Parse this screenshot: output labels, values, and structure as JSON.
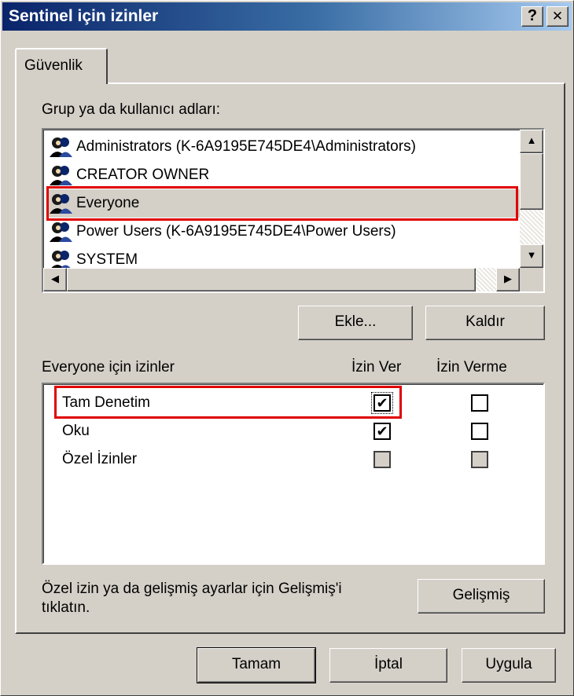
{
  "window": {
    "title": "Sentinel için izinler",
    "help_label": "?",
    "close_label": "✕"
  },
  "tabs": [
    {
      "label": "Güvenlik"
    }
  ],
  "users": {
    "label": "Grup ya da kullanıcı adları:",
    "items": [
      {
        "name": "Administrators (K-6A9195E745DE4\\Administrators)"
      },
      {
        "name": "CREATOR OWNER"
      },
      {
        "name": "Everyone",
        "selected": true
      },
      {
        "name": "Power Users (K-6A9195E745DE4\\Power Users)"
      },
      {
        "name": "SYSTEM"
      }
    ],
    "add_label": "Ekle...",
    "remove_label": "Kaldır"
  },
  "permissions": {
    "label": "Everyone için izinler",
    "allow_header": "İzin Ver",
    "deny_header": "İzin Verme",
    "rows": [
      {
        "name": "Tam Denetim",
        "allow": true,
        "deny": false,
        "disabled": false
      },
      {
        "name": "Oku",
        "allow": true,
        "deny": false,
        "disabled": false
      },
      {
        "name": "Özel İzinler",
        "allow": false,
        "deny": false,
        "disabled": true
      }
    ]
  },
  "advanced": {
    "text_line1": "Özel izin ya da gelişmiş ayarlar için Gelişmiş'i",
    "text_line2": "tıklatın.",
    "button_label": "Gelişmiş"
  },
  "footer": {
    "ok_label": "Tamam",
    "cancel_label": "İptal",
    "apply_label": "Uygula"
  },
  "colors": {
    "titlebar_start": "#0a246a",
    "titlebar_end": "#a6caf0",
    "face": "#d4d0c8",
    "highlight": "#e00000"
  }
}
